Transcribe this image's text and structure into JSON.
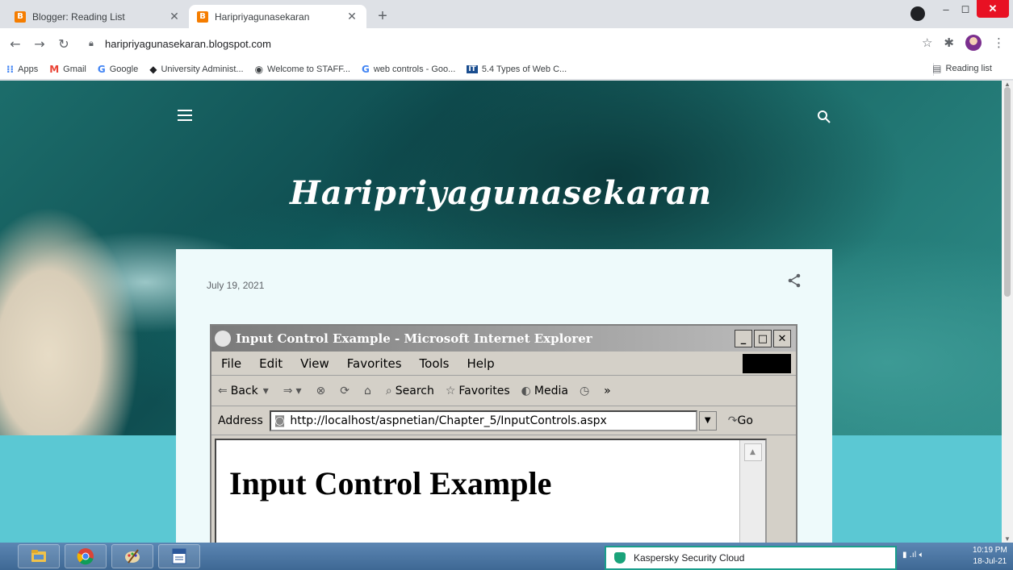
{
  "browser": {
    "tabs": [
      {
        "label": "Blogger: Reading List",
        "favicon": "B"
      },
      {
        "label": "Haripriyagunasekaran",
        "favicon": "B"
      }
    ],
    "new_tab_label": "+",
    "window_controls": {
      "minimize": "–",
      "maximize": "◻",
      "close": "✕"
    },
    "url": "haripriyagunasekaran.blogspot.com",
    "bookmarks": [
      {
        "label": "Apps",
        "icon": "apps-grid-icon"
      },
      {
        "label": "Gmail",
        "icon": "gmail-icon"
      },
      {
        "label": "Google",
        "icon": "google-icon"
      },
      {
        "label": "University Administ...",
        "icon": "graduation-cap-icon"
      },
      {
        "label": "Welcome to STAFF...",
        "icon": "globe-icon"
      },
      {
        "label": "web controls - Goo...",
        "icon": "google-icon"
      },
      {
        "label": "5.4 Types of Web C...",
        "icon": "site-icon"
      }
    ],
    "reading_list": "Reading list"
  },
  "blog": {
    "title": "Haripriyagunasekaran",
    "post_date": "July 19, 2021"
  },
  "embedded_image": {
    "window_title": "Input Control Example - Microsoft Internet Explorer",
    "menu": [
      "File",
      "Edit",
      "View",
      "Favorites",
      "Tools",
      "Help"
    ],
    "nav": {
      "back": "Back",
      "search": "Search",
      "favorites": "Favorites",
      "media": "Media",
      "more": "»"
    },
    "address_label": "Address",
    "address_url": "http://localhost/aspnetian/Chapter_5/InputControls.aspx",
    "go_label": "Go",
    "heading": "Input Control Example"
  },
  "taskbar": {
    "notification": "Kaspersky Security Cloud",
    "time": "10:19 PM",
    "date": "18-Jul-21"
  },
  "colors": {
    "accent": "#f57d00",
    "page_background": "#5bc8d3",
    "taskbar": "#4a76a4"
  }
}
